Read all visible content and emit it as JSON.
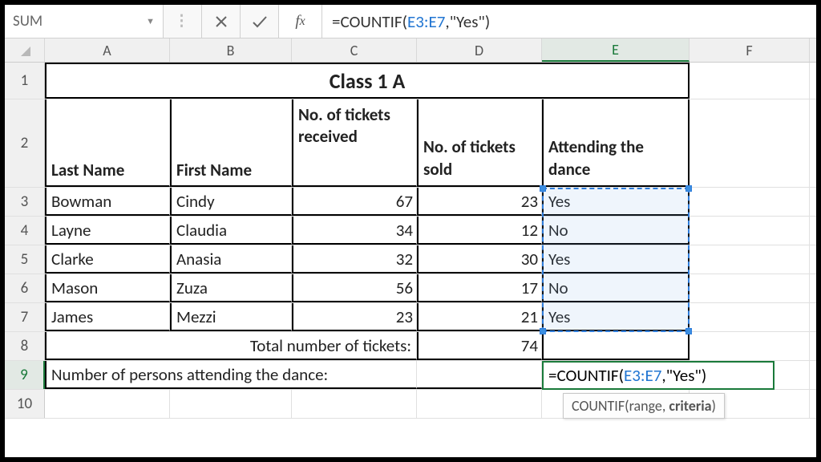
{
  "namebox": "SUM",
  "formula_bar": {
    "prefix": "=COUNTIF(",
    "ref": "E3:E7",
    "suffix": ",\"Yes\")"
  },
  "columns": [
    "A",
    "B",
    "C",
    "D",
    "E",
    "F"
  ],
  "active_col": "E",
  "active_row": "9",
  "row_labels": [
    "1",
    "2",
    "3",
    "4",
    "5",
    "6",
    "7",
    "8",
    "9",
    "10"
  ],
  "title": "Class 1 A",
  "headers": {
    "a": "Last Name",
    "b": "First Name",
    "c": "No. of tickets received",
    "d": "No. of tickets sold",
    "e": "Attending the dance"
  },
  "rows": [
    {
      "last": "Bowman",
      "first": "Cindy",
      "recv": 67,
      "sold": 23,
      "att": "Yes"
    },
    {
      "last": "Layne",
      "first": "Claudia",
      "recv": 34,
      "sold": 12,
      "att": "No"
    },
    {
      "last": "Clarke",
      "first": "Anasia",
      "recv": 32,
      "sold": 30,
      "att": "Yes"
    },
    {
      "last": "Mason",
      "first": "Zuza",
      "recv": 56,
      "sold": 17,
      "att": "No"
    },
    {
      "last": "James",
      "first": "Mezzi",
      "recv": 23,
      "sold": 21,
      "att": "Yes"
    }
  ],
  "totals_label": "Total number of tickets:",
  "totals_value": 74,
  "dance_label": "Number of persons attending the dance:",
  "edit_cell": {
    "prefix": "=COUNTIF(",
    "ref": "E3:E7",
    "suffix": ",\"Yes\")"
  },
  "tooltip": {
    "fn": "COUNTIF",
    "arg1": "range",
    "arg2": "criteria"
  },
  "chart_data": {
    "type": "table",
    "columns": [
      "Last Name",
      "First Name",
      "No. of tickets received",
      "No. of tickets sold",
      "Attending the dance"
    ],
    "rows": [
      [
        "Bowman",
        "Cindy",
        67,
        23,
        "Yes"
      ],
      [
        "Layne",
        "Claudia",
        34,
        12,
        "No"
      ],
      [
        "Clarke",
        "Anasia",
        32,
        30,
        "Yes"
      ],
      [
        "Mason",
        "Zuza",
        56,
        17,
        "No"
      ],
      [
        "James",
        "Mezzi",
        23,
        21,
        "Yes"
      ]
    ],
    "totals": {
      "label": "Total number of tickets:",
      "value": 74
    }
  }
}
